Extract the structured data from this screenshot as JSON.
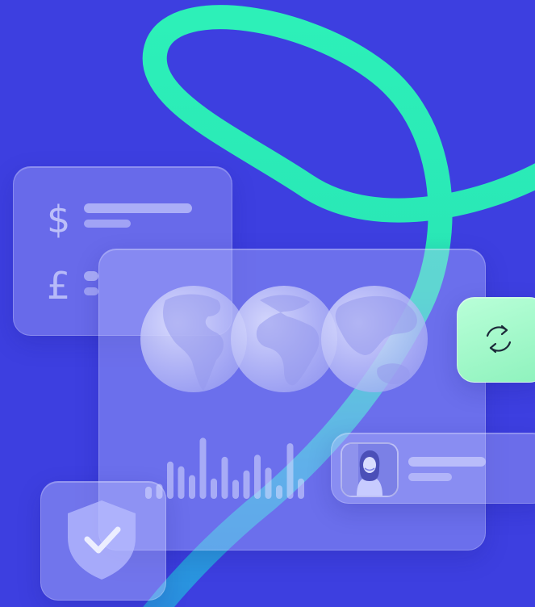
{
  "colors": {
    "background": "#3d3fe0",
    "ribbon_light": "#2df0b8",
    "ribbon_dark": "#2a9fe0",
    "glass_line": "#dfe2ff",
    "sync_card": "#a8f7cc",
    "icon_stroke": "#1d2a3a"
  },
  "currency_card": {
    "symbols": [
      "$",
      "£"
    ]
  },
  "icons": {
    "globes": [
      "globe-americas-icon",
      "globe-africa-europe-icon",
      "globe-asia-australia-icon"
    ],
    "sync": "sync-icon",
    "shield": "shield-check-icon",
    "avatar": "person-avatar"
  },
  "bar_chart": {
    "levels": [
      0.18,
      0.22,
      0.55,
      0.48,
      0.35,
      0.9,
      0.3,
      0.62,
      0.28,
      0.42,
      0.65,
      0.46,
      0.2,
      0.82,
      0.3
    ]
  }
}
